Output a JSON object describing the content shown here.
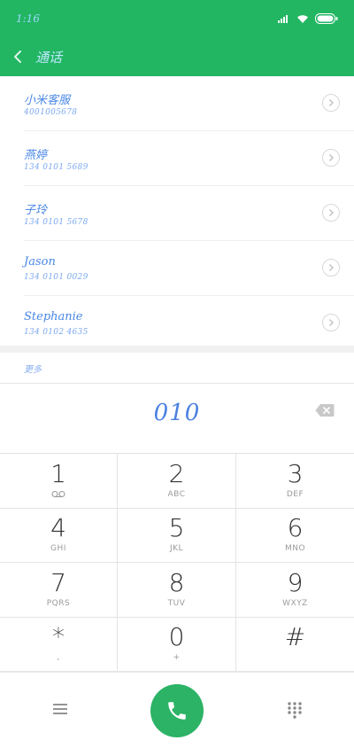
{
  "status_bar": {
    "time": "1:16"
  },
  "header": {
    "title": "通话"
  },
  "contacts": [
    {
      "name": "小米客服",
      "number": "4001005678"
    },
    {
      "name": "燕婷",
      "number": "134 0101 5689"
    },
    {
      "name": "子玲",
      "number": "134 0101 5678"
    },
    {
      "name": "Jason",
      "number": "134 0101 0029"
    },
    {
      "name": "Stephanie",
      "number": "134 0102 4635"
    }
  ],
  "more_label": "更多",
  "dialed_number": "010",
  "keys": [
    {
      "digit": "1",
      "sub": "voicemail-icon"
    },
    {
      "digit": "2",
      "sub": "ABC"
    },
    {
      "digit": "3",
      "sub": "DEF"
    },
    {
      "digit": "4",
      "sub": "GHI"
    },
    {
      "digit": "5",
      "sub": "JKL"
    },
    {
      "digit": "6",
      "sub": "MNO"
    },
    {
      "digit": "7",
      "sub": "PQRS"
    },
    {
      "digit": "8",
      "sub": "TUV"
    },
    {
      "digit": "9",
      "sub": "WXYZ"
    },
    {
      "digit": "*",
      "sub": ","
    },
    {
      "digit": "0",
      "sub": "+"
    },
    {
      "digit": "#",
      "sub": ""
    }
  ],
  "colors": {
    "accent": "#22b663",
    "call": "#2cb366"
  }
}
